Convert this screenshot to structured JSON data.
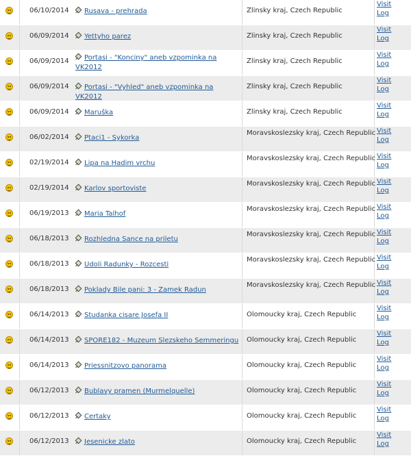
{
  "rows": [
    {
      "date": "06/10/2014",
      "name": "Rusava - prehrada",
      "location": "Zlinsky kraj, Czech Republic",
      "visit": "Visit",
      "log": "Log"
    },
    {
      "date": "06/09/2014",
      "name": "Yettyho parez",
      "location": "Zlinsky kraj, Czech Republic",
      "visit": "Visit",
      "log": "Log"
    },
    {
      "date": "06/09/2014",
      "name": "Portasi - \"Konciny\" aneb vzpominka na VK2012",
      "location": "Zlinsky kraj, Czech Republic",
      "visit": "Visit",
      "log": "Log"
    },
    {
      "date": "06/09/2014",
      "name": "Portasi - \"Vyhled\" aneb vzpominka na VK2012",
      "location": "Zlinsky kraj, Czech Republic",
      "visit": "Visit",
      "log": "Log"
    },
    {
      "date": "06/09/2014",
      "name": "Maruška",
      "location": "Zlinsky kraj, Czech Republic",
      "visit": "Visit",
      "log": "Log"
    },
    {
      "date": "06/02/2014",
      "name": "Ptaci1 - Sykorka",
      "location": "Moravskoslezsky kraj, Czech Republic",
      "visit": "Visit",
      "log": "Log"
    },
    {
      "date": "02/19/2014",
      "name": "Lipa na Hadim vrchu",
      "location": "Moravskoslezsky kraj, Czech Republic",
      "visit": "Visit",
      "log": "Log"
    },
    {
      "date": "02/19/2014",
      "name": "Karlov sportoviste",
      "location": "Moravskoslezsky kraj, Czech Republic",
      "visit": "Visit",
      "log": "Log"
    },
    {
      "date": "06/19/2013",
      "name": "Maria Talhof",
      "location": "Moravskoslezsky kraj, Czech Republic",
      "visit": "Visit",
      "log": "Log"
    },
    {
      "date": "06/18/2013",
      "name": "Rozhledna Sance na priletu",
      "location": "Moravskoslezsky kraj, Czech Republic",
      "visit": "Visit",
      "log": "Log"
    },
    {
      "date": "06/18/2013",
      "name": "Udoli Radunky - Rozcesti",
      "location": "Moravskoslezsky kraj, Czech Republic",
      "visit": "Visit",
      "log": "Log"
    },
    {
      "date": "06/18/2013",
      "name": "Poklady Bile pani: 3 - Zamek Radun",
      "location": "Moravskoslezsky kraj, Czech Republic",
      "visit": "Visit",
      "log": "Log"
    },
    {
      "date": "06/14/2013",
      "name": "Studanka cisare Josefa II",
      "location": "Olomoucky kraj, Czech Republic",
      "visit": "Visit",
      "log": "Log"
    },
    {
      "date": "06/14/2013",
      "name": "SPORE182 - Muzeum Slezskeho Semmeringu",
      "location": "Olomoucky kraj, Czech Republic",
      "visit": "Visit",
      "log": "Log"
    },
    {
      "date": "06/14/2013",
      "name": "Priessnitzovo panorama",
      "location": "Olomoucky kraj, Czech Republic",
      "visit": "Visit",
      "log": "Log"
    },
    {
      "date": "06/12/2013",
      "name": "Bublavy pramen (Murmelquelle)",
      "location": "Olomoucky kraj, Czech Republic",
      "visit": "Visit",
      "log": "Log"
    },
    {
      "date": "06/12/2013",
      "name": "Certaky",
      "location": "Olomoucky kraj, Czech Republic",
      "visit": "Visit",
      "log": "Log"
    },
    {
      "date": "06/12/2013",
      "name": "Jesenicke zlato",
      "location": "Olomoucky kraj, Czech Republic",
      "visit": "Visit",
      "log": "Log"
    }
  ]
}
